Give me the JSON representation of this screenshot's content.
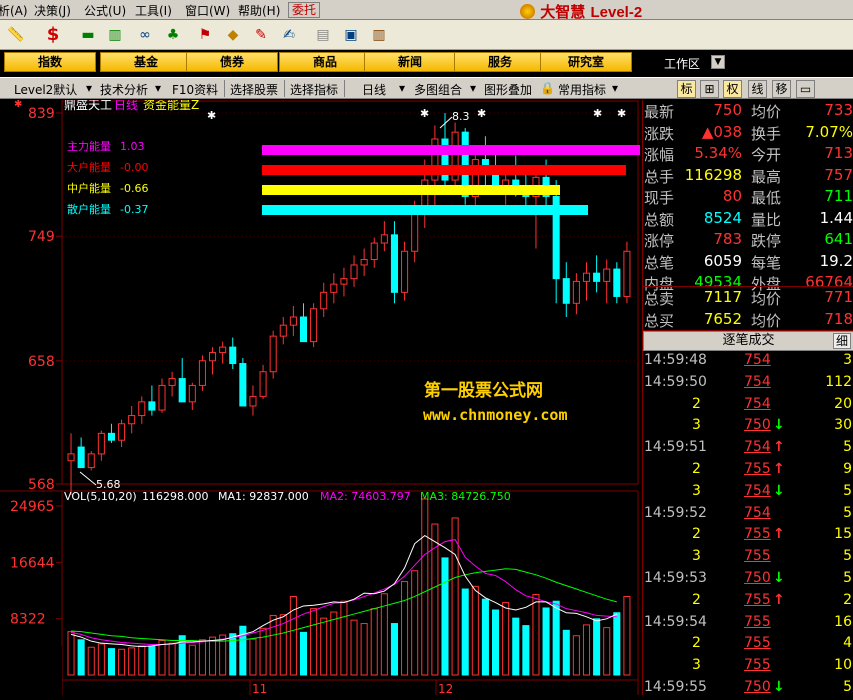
{
  "menu": {
    "items": [
      "析(A)",
      "决策(J)",
      "公式(U)",
      "工具(I)",
      "窗口(W)",
      "帮助(H)"
    ],
    "entrust": "委托"
  },
  "brand": {
    "name": "大智慧",
    "edition": "Level-2"
  },
  "nav": {
    "buttons": [
      "指数",
      "基金",
      "债券",
      "商品",
      "新闻",
      "服务",
      "研究室"
    ],
    "workspace": "工作区",
    "workspace_drop": "▼"
  },
  "ctrl": {
    "items": [
      "Level2默认",
      "技术分析",
      "F10资料",
      "选择股票",
      "选择指标",
      "日线",
      "多图组合",
      "图形叠加",
      "常用指标"
    ],
    "tabs": [
      "标",
      "⊞",
      "权",
      "线",
      "移",
      "▭"
    ]
  },
  "chart": {
    "stock": "鼎盛天工",
    "period": "日线",
    "indicator": "资金能量Z",
    "energy": [
      {
        "label": "主力能量",
        "value": "1.03",
        "color": "#ff00ff"
      },
      {
        "label": "大户能量",
        "value": "-0.00",
        "color": "#ff0000"
      },
      {
        "label": "中户能量",
        "value": "-0.66",
        "color": "#ffff00"
      },
      {
        "label": "散户能量",
        "value": "-0.37",
        "color": "#00ffff"
      }
    ],
    "price_axis": [
      "839",
      "749",
      "658",
      "568"
    ],
    "price_range": [
      568,
      839
    ],
    "high_label": "8.3",
    "low_label": "5.68",
    "vol_line": {
      "name": "VOL(5,10,20)",
      "vol": "116298.000",
      "ma1": "MA1: 92837.000",
      "ma2": "MA2: 74603.797",
      "ma3": "MA3: 84726.750"
    },
    "vol_axis": [
      "24965",
      "16644",
      "8322"
    ],
    "vol_max": 24965,
    "watermark1": "第一股票公式网",
    "watermark2": "www.chnmoney.com",
    "months": [
      "11",
      "12"
    ],
    "colors": {
      "up": "#ff3232",
      "down": "#00ffff",
      "ma1": "#ffffff",
      "ma2": "#ff00ff",
      "ma3": "#00ff00",
      "axis": "#800000",
      "grid": "#800000"
    },
    "candles": [
      [
        585,
        605,
        560,
        590
      ],
      [
        595,
        602,
        588,
        580
      ],
      [
        580,
        592,
        578,
        590
      ],
      [
        590,
        607,
        585,
        605
      ],
      [
        605,
        612,
        598,
        600
      ],
      [
        600,
        615,
        595,
        612
      ],
      [
        612,
        625,
        605,
        618
      ],
      [
        618,
        632,
        612,
        628
      ],
      [
        628,
        640,
        618,
        622
      ],
      [
        622,
        645,
        620,
        640
      ],
      [
        640,
        650,
        632,
        645
      ],
      [
        645,
        660,
        638,
        628
      ],
      [
        628,
        642,
        622,
        640
      ],
      [
        640,
        662,
        636,
        658
      ],
      [
        658,
        668,
        648,
        664
      ],
      [
        664,
        672,
        656,
        668
      ],
      [
        668,
        675,
        652,
        656
      ],
      [
        656,
        660,
        640,
        625
      ],
      [
        625,
        640,
        618,
        632
      ],
      [
        632,
        655,
        630,
        650
      ],
      [
        650,
        680,
        645,
        676
      ],
      [
        676,
        690,
        670,
        684
      ],
      [
        684,
        698,
        676,
        690
      ],
      [
        690,
        700,
        680,
        672
      ],
      [
        672,
        700,
        668,
        696
      ],
      [
        696,
        715,
        690,
        708
      ],
      [
        708,
        722,
        700,
        714
      ],
      [
        714,
        726,
        705,
        718
      ],
      [
        718,
        735,
        712,
        728
      ],
      [
        728,
        740,
        720,
        732
      ],
      [
        732,
        748,
        726,
        744
      ],
      [
        744,
        760,
        738,
        750
      ],
      [
        750,
        760,
        700,
        708
      ],
      [
        708,
        745,
        702,
        738
      ],
      [
        738,
        775,
        730,
        768
      ],
      [
        768,
        805,
        755,
        790
      ],
      [
        790,
        830,
        770,
        820
      ],
      [
        820,
        839,
        780,
        790
      ],
      [
        790,
        832,
        780,
        825
      ],
      [
        825,
        828,
        772,
        778
      ],
      [
        778,
        812,
        770,
        805
      ],
      [
        805,
        822,
        786,
        795
      ],
      [
        795,
        815,
        780,
        782
      ],
      [
        782,
        800,
        772,
        790
      ],
      [
        790,
        808,
        778,
        785
      ],
      [
        785,
        800,
        770,
        778
      ],
      [
        778,
        798,
        740,
        792
      ],
      [
        792,
        805,
        770,
        778
      ],
      [
        778,
        790,
        700,
        718
      ],
      [
        718,
        730,
        690,
        700
      ],
      [
        700,
        722,
        692,
        716
      ],
      [
        716,
        730,
        702,
        722
      ],
      [
        722,
        735,
        708,
        716
      ],
      [
        716,
        732,
        700,
        725
      ],
      [
        725,
        730,
        700,
        705
      ],
      [
        705,
        745,
        700,
        738
      ]
    ],
    "volumes": [
      6400,
      5200,
      4100,
      4600,
      3900,
      3800,
      4000,
      4300,
      4200,
      5100,
      4700,
      5800,
      4400,
      5200,
      5600,
      5900,
      6100,
      7200,
      5300,
      6900,
      8800,
      8900,
      11600,
      6300,
      9800,
      8400,
      9300,
      10900,
      8100,
      7600,
      9800,
      12000,
      7600,
      13800,
      15400,
      26000,
      22300,
      17300,
      23200,
      12700,
      13100,
      11200,
      9600,
      10700,
      8400,
      7300,
      11900,
      9900,
      10900,
      6600,
      5800,
      7400,
      8300,
      7000,
      9200,
      11600
    ],
    "ma1": [
      6000,
      5600,
      5000,
      4700,
      4600,
      4500,
      4300,
      4200,
      4300,
      4500,
      4600,
      4900,
      4900,
      5000,
      5100,
      5200,
      5600,
      6000,
      6400,
      7300,
      8100,
      8600,
      9600,
      10200,
      10300,
      10500,
      10800,
      10700,
      11200,
      12100,
      12000,
      12400,
      13500,
      15800,
      19400,
      20600,
      19700,
      18800,
      17800,
      14600,
      12500,
      11400,
      10700,
      9900,
      9600,
      10000,
      10800,
      10800,
      9900,
      9200,
      9100,
      8600,
      8000,
      8300,
      9000
    ],
    "ma2": [
      6300,
      6000,
      5500,
      5200,
      5000,
      4800,
      4700,
      4600,
      4500,
      4500,
      4600,
      4700,
      4800,
      4900,
      5100,
      5300,
      5500,
      5800,
      6200,
      6600,
      7100,
      7600,
      8300,
      9000,
      9500,
      10100,
      10600,
      10700,
      11100,
      11600,
      12100,
      12700,
      13400,
      14600,
      16200,
      17800,
      18800,
      19700,
      20000,
      17400,
      16100,
      15000,
      14700,
      13800,
      12600,
      11700,
      11300,
      10800,
      10500,
      9800,
      9500,
      9200,
      8800,
      8700,
      8600
    ],
    "ma3": [
      6500,
      6400,
      6200,
      6000,
      5800,
      5700,
      5500,
      5400,
      5300,
      5200,
      5100,
      5100,
      5100,
      5000,
      5000,
      5000,
      5100,
      5200,
      5400,
      5600,
      5900,
      6200,
      6600,
      7000,
      7400,
      7800,
      8200,
      8600,
      9000,
      9400,
      9800,
      10200,
      10600,
      11000,
      11600,
      12300,
      13000,
      13700,
      14400,
      14800,
      15100,
      15300,
      15500,
      15700,
      15600,
      15200,
      14800,
      14300,
      13700,
      13200,
      12700,
      12200,
      11700,
      11200,
      10800
    ]
  },
  "quote": {
    "rows": [
      {
        "l1": "最新",
        "v1": "750",
        "c1": "#ff3232",
        "l2": "均价",
        "v2": "733",
        "c2": "#ff3232"
      },
      {
        "l1": "涨跌",
        "v1": "▲038",
        "c1": "#ff3232",
        "l2": "换手",
        "v2": "7.07%",
        "c2": "#ffff00"
      },
      {
        "l1": "涨幅",
        "v1": "5.34%",
        "c1": "#ff3232",
        "l2": "今开",
        "v2": "713",
        "c2": "#ff3232"
      },
      {
        "l1": "总手",
        "v1": "116298",
        "c1": "#ffff00",
        "l2": "最高",
        "v2": "757",
        "c2": "#ff3232"
      },
      {
        "l1": "现手",
        "v1": "80",
        "c1": "#ff3232",
        "l2": "最低",
        "v2": "711",
        "c2": "#00ff00"
      },
      {
        "l1": "总额",
        "v1": "8524",
        "c1": "#00ffff",
        "l2": "量比",
        "v2": "1.44",
        "c2": "#ffffff"
      },
      {
        "l1": "涨停",
        "v1": "783",
        "c1": "#ff3232",
        "l2": "跌停",
        "v2": "641",
        "c2": "#00ff00"
      },
      {
        "l1": "总笔",
        "v1": "6059",
        "c1": "#ffffff",
        "l2": "每笔",
        "v2": "19.2",
        "c2": "#ffffff"
      },
      {
        "l1": "内盘",
        "v1": "49534",
        "c1": "#00ff00",
        "l2": "外盘",
        "v2": "66764",
        "c2": "#ff3232"
      },
      {
        "l1": "总卖",
        "v1": "7117",
        "c1": "#ffff00",
        "l2": "均价",
        "v2": "771",
        "c2": "#ff3232"
      },
      {
        "l1": "总买",
        "v1": "7652",
        "c1": "#ffff00",
        "l2": "均价",
        "v2": "718",
        "c2": "#ff3232"
      }
    ],
    "trade_title": "逐笔成交",
    "trade_btn": "细",
    "trades": [
      {
        "t": "14:59:48",
        "p": "754",
        "a": "",
        "v": "3",
        "pc": "#ff3232"
      },
      {
        "t": "14:59:50",
        "p": "754",
        "a": "",
        "v": "112",
        "pc": "#ff3232"
      },
      {
        "t": "2",
        "p": "754",
        "a": "",
        "v": "20",
        "pc": "#ff3232"
      },
      {
        "t": "3",
        "p": "750",
        "a": "↓",
        "v": "30",
        "pc": "#ff3232"
      },
      {
        "t": "14:59:51",
        "p": "754",
        "a": "↑",
        "v": "5",
        "pc": "#ff3232"
      },
      {
        "t": "2",
        "p": "755",
        "a": "↑",
        "v": "9",
        "pc": "#ff3232"
      },
      {
        "t": "3",
        "p": "754",
        "a": "↓",
        "v": "5",
        "pc": "#ff3232"
      },
      {
        "t": "14:59:52",
        "p": "754",
        "a": "",
        "v": "5",
        "pc": "#ff3232"
      },
      {
        "t": "2",
        "p": "755",
        "a": "↑",
        "v": "15",
        "pc": "#ff3232"
      },
      {
        "t": "3",
        "p": "755",
        "a": "",
        "v": "5",
        "pc": "#ff3232"
      },
      {
        "t": "14:59:53",
        "p": "750",
        "a": "↓",
        "v": "5",
        "pc": "#ff3232"
      },
      {
        "t": "2",
        "p": "755",
        "a": "↑",
        "v": "2",
        "pc": "#ff3232"
      },
      {
        "t": "14:59:54",
        "p": "755",
        "a": "",
        "v": "16",
        "pc": "#ff3232"
      },
      {
        "t": "2",
        "p": "755",
        "a": "",
        "v": "4",
        "pc": "#ff3232"
      },
      {
        "t": "3",
        "p": "755",
        "a": "",
        "v": "10",
        "pc": "#ff3232"
      },
      {
        "t": "14:59:55",
        "p": "750",
        "a": "↓",
        "v": "5",
        "pc": "#ff3232"
      }
    ]
  }
}
